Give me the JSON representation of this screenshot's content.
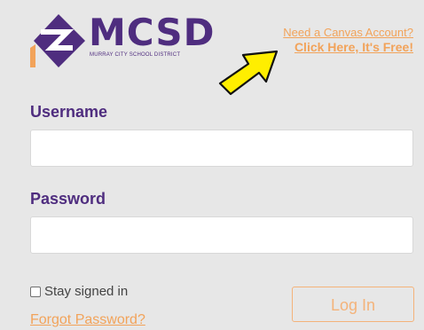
{
  "logo": {
    "title": "MCSD",
    "subtitle": "MURRAY CITY SCHOOL DISTRICT"
  },
  "signup": {
    "line1": "Need a Canvas Account?",
    "line2": "Click Here, It's Free!"
  },
  "form": {
    "username_label": "Username",
    "username_value": "",
    "password_label": "Password",
    "password_value": "",
    "remember_label": "Stay signed in",
    "remember_checked": false,
    "forgot_link": "Forgot Password?",
    "login_button": "Log In"
  },
  "colors": {
    "brand_purple": "#4f2d7f",
    "accent_orange": "#f2a35a",
    "arrow_yellow": "#ffee00",
    "background": "#e7e7e7"
  },
  "icons": {
    "logo": "mcsd-logo-icon",
    "pointer": "arrow-pointer-icon"
  }
}
